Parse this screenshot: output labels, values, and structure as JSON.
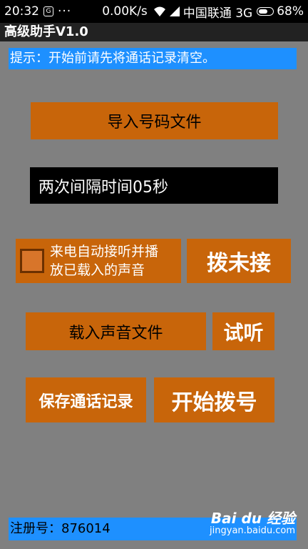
{
  "status_bar": {
    "time": "20:32",
    "app_icon_glyph": "G",
    "dots": "···",
    "speed": "0.00K/s",
    "carrier": "中国联通 3G",
    "battery_text": "68%",
    "battery_level": 0.68,
    "icons": [
      "wifi-icon",
      "signal-icon",
      "battery-icon"
    ]
  },
  "title_bar": {
    "title": "高级助手V1.0"
  },
  "hint": {
    "text": "提示：开始前请先将通话记录清空。"
  },
  "buttons": {
    "import_numbers": "导入号码文件",
    "auto_answer_label_line1": "来电自动接听并播",
    "auto_answer_label_line2": "放已载入的声音",
    "dial_unanswered": "拨未接",
    "load_sound": "载入声音文件",
    "preview": "试听",
    "save_call_log": "保存通话记录",
    "start_dialing": "开始拨号"
  },
  "interval": {
    "text": "两次间隔时间05秒"
  },
  "auto_answer_checked": false,
  "footer": {
    "text": "注册号：876014"
  },
  "watermark": {
    "brand": "Bai du 经验",
    "url": "jingyan.baidu.com"
  },
  "colors": {
    "background": "#808080",
    "button": "#c8650a",
    "hint_bar": "#1e90ff",
    "interval_box": "#000000"
  }
}
